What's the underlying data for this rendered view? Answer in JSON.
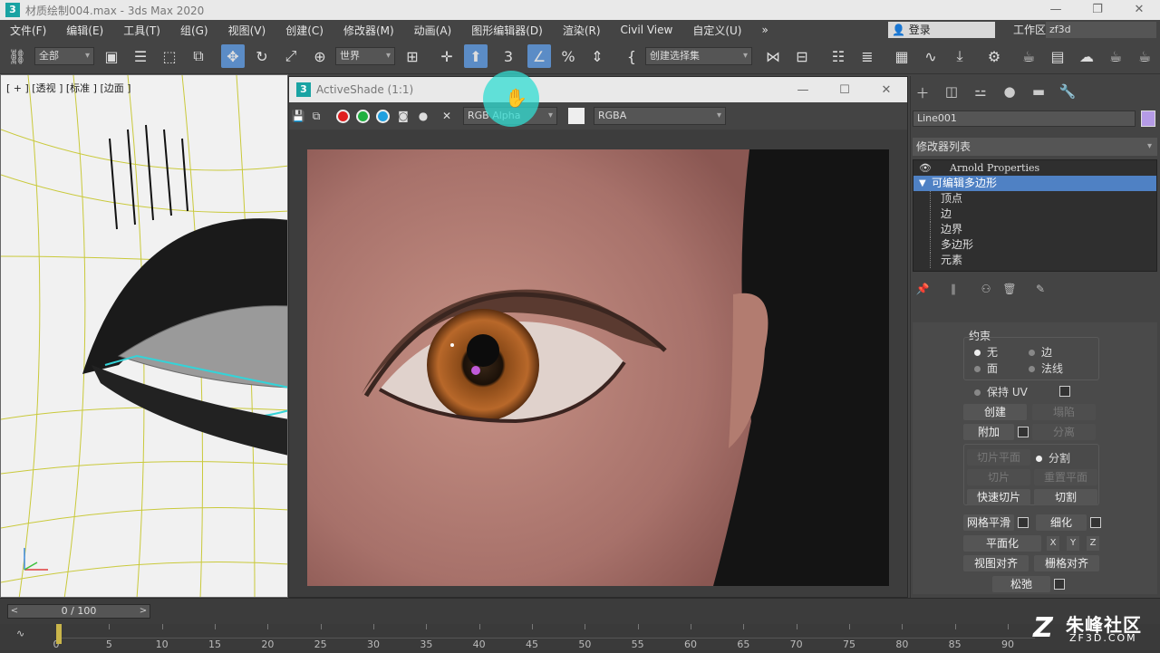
{
  "window": {
    "title": "材质绘制004.max - 3ds Max 2020",
    "app_icon": "3",
    "controls": [
      "—",
      "❐",
      "✕"
    ]
  },
  "menu": {
    "items": [
      "文件(F)",
      "编辑(E)",
      "工具(T)",
      "组(G)",
      "视图(V)",
      "创建(C)",
      "修改器(M)",
      "动画(A)",
      "图形编辑器(D)",
      "渲染(R)",
      "Civil View",
      "自定义(U)"
    ],
    "overflow": "»",
    "login": "登录",
    "workspace_label": "工作区:",
    "workspace_value": "zf3d"
  },
  "toolbar": {
    "selection_filter": "全部",
    "ref_coord": "世界",
    "named_selection": "创建选择集",
    "angle_snap_label": "3"
  },
  "viewport": {
    "label": "[ + ] [透视 ] [标准 ] [边面 ]"
  },
  "activeshade": {
    "title": "ActiveShade (1:1)",
    "app_icon": "3",
    "channel": "RGB Alpha",
    "display_channel": "RGBA",
    "controls": [
      "—",
      "☐",
      "✕"
    ]
  },
  "command_panel": {
    "object_name": "Line001",
    "modifier_list": "修改器列表",
    "stack": {
      "top": "Arnold Properties",
      "selected": "可编辑多边形",
      "sub_items": [
        "顶点",
        "边",
        "边界",
        "多边形",
        "元素"
      ]
    },
    "rollout": {
      "constraints_label": "约束",
      "constraint_none": "无",
      "constraint_edge": "边",
      "constraint_face": "面",
      "constraint_normal": "法线",
      "preserve_uv": "保持 UV",
      "create": "创建",
      "collapse": "塌陷",
      "attach": "附加",
      "detach": "分离",
      "slice_plane": "切片平面",
      "split": "分割",
      "slice": "切片",
      "reset_plane": "重置平面",
      "quickslice": "快速切片",
      "cut": "切割",
      "meshsmooth": "网格平滑",
      "tessellate": "细化",
      "make_planar": "平面化",
      "x": "X",
      "y": "Y",
      "z": "Z",
      "view_align": "视图对齐",
      "grid_align": "栅格对齐",
      "relax": "松弛"
    }
  },
  "timeline": {
    "slider_value": "0 / 100",
    "prev": "<",
    "next": ">",
    "ticks": [
      "0",
      "5",
      "10",
      "15",
      "20",
      "25",
      "30",
      "35",
      "40",
      "45",
      "50",
      "55",
      "60",
      "65",
      "70",
      "75",
      "80",
      "85",
      "90"
    ],
    "current_frame": 0
  },
  "watermark": {
    "logo": "Z",
    "cn": "朱峰社区",
    "en": "ZF3D.COM"
  },
  "colors": {
    "accent": "#5b8cc6",
    "selected_stack": "#4f81c4",
    "cursor_highlight": "#32dcd2",
    "object_color": "#b59be6"
  }
}
